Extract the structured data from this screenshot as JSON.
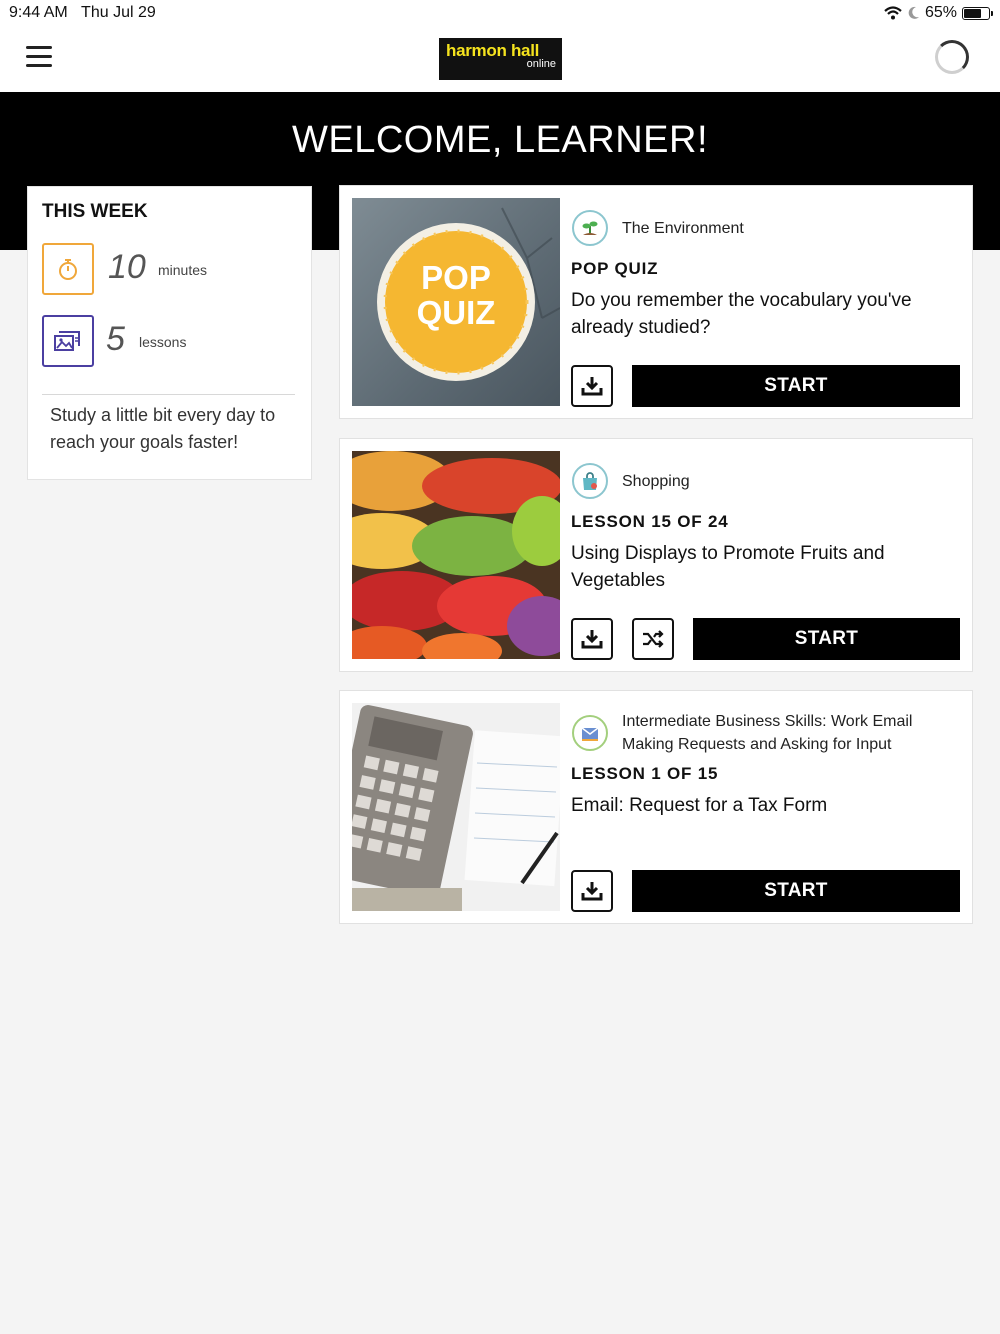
{
  "status_bar": {
    "time": "9:44 AM",
    "date": "Thu Jul 29",
    "battery": "65%"
  },
  "header": {
    "logo_main": "harmon hall",
    "logo_sub": "online",
    "menu_icon": "hamburger-icon"
  },
  "hero": {
    "title": "WELCOME, LEARNER!"
  },
  "this_week": {
    "heading": "THIS WEEK",
    "minutes_value": "10",
    "minutes_label": "minutes",
    "lessons_value": "5",
    "lessons_label": "lessons",
    "tip": "Study a little bit every day to reach your goals faster!",
    "colors": {
      "minutes": "#f0a73a",
      "lessons": "#4b3fa1"
    }
  },
  "lessons": [
    {
      "category": "The Environment",
      "kind": "POP QUIZ",
      "title": "Do you remember the vocabulary you've already studied?",
      "badge_line1": "POP",
      "badge_line2": "QUIZ",
      "start_label": "START"
    },
    {
      "category": "Shopping",
      "kind": "LESSON 15 OF 24",
      "title": "Using Displays to Promote Fruits and Vegetables",
      "start_label": "START"
    },
    {
      "category": "Intermediate Business Skills: Work Email Making Requests and Asking for Input",
      "kind": "LESSON 1 OF 15",
      "title": "Email: Request for a Tax Form",
      "start_label": "START"
    }
  ]
}
